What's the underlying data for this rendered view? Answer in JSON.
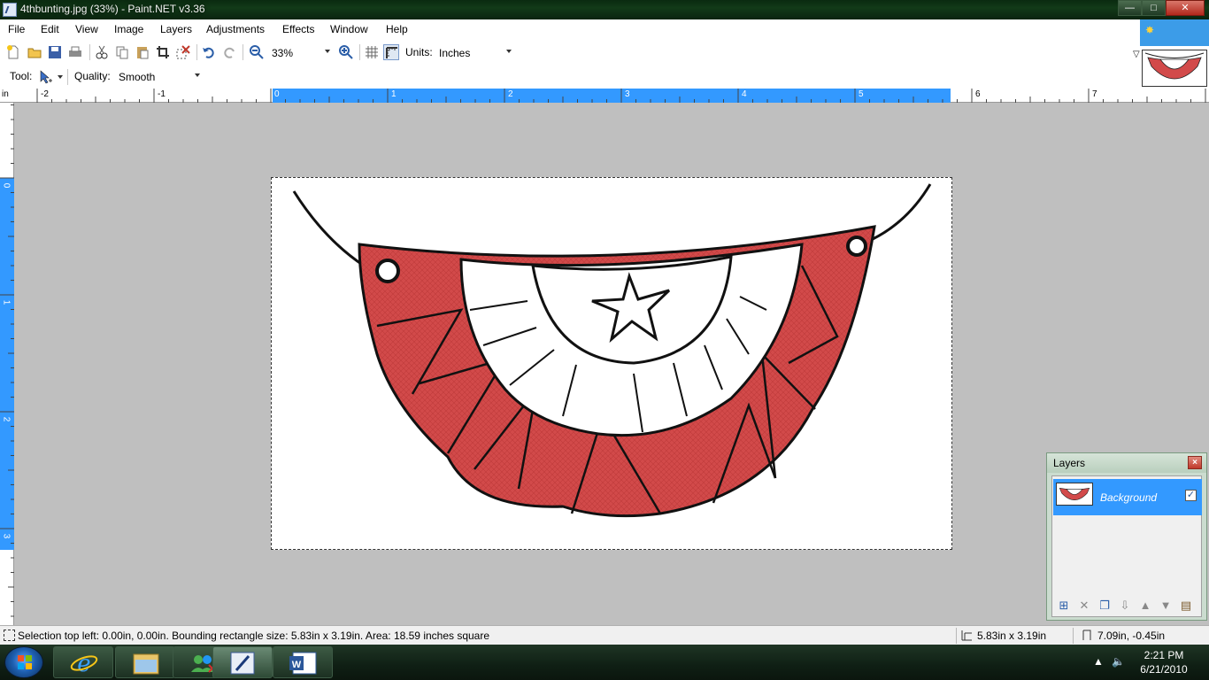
{
  "window": {
    "title": "4thbunting.jpg (33%) - Paint.NET v3.36",
    "controls": {
      "minimize": "—",
      "maximize": "□",
      "close": "✕"
    }
  },
  "menu": [
    "File",
    "Edit",
    "View",
    "Image",
    "Layers",
    "Adjustments",
    "Effects",
    "Window",
    "Help"
  ],
  "toolbar": {
    "zoom_value": "33%",
    "units_label": "Units:",
    "units_value": "Inches"
  },
  "toolbar2": {
    "tool_label": "Tool:",
    "quality_label": "Quality:",
    "quality_value": "Smooth"
  },
  "ruler": {
    "unit": "in",
    "h_labels": [
      "-2",
      "-1",
      "0",
      "1",
      "2",
      "3",
      "4",
      "5",
      "6",
      "7"
    ],
    "v_labels": [
      "0",
      "1",
      "2",
      "3"
    ]
  },
  "layers_panel": {
    "title": "Layers",
    "layer_name": "Background",
    "visible": true
  },
  "status": {
    "selection_text": "Selection top left: 0.00in, 0.00in. Bounding rectangle size: 5.83in x 3.19in. Area: 18.59 inches square",
    "size": "5.83in x 3.19in",
    "cursor": "7.09in, -0.45in"
  },
  "taskbar": {
    "time": "2:21 PM",
    "date": "6/21/2010"
  },
  "colors": {
    "accent": "#3399ff",
    "canvas_bg": "#bfbfbf",
    "bunting_red": "#d24a4a"
  }
}
